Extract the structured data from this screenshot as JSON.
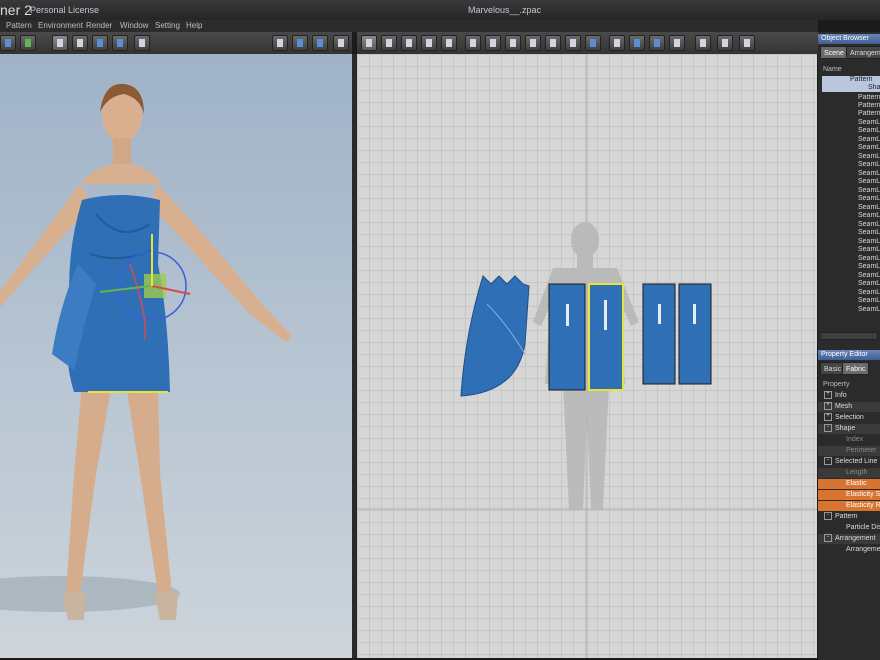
{
  "window": {
    "app_title": "ner 2",
    "license": "Personal License",
    "file_title": "Marvelous__.zpac"
  },
  "menu": [
    "Pattern",
    "Environment",
    "Render",
    "Window",
    "Setting",
    "Help"
  ],
  "object_browser": {
    "title": "Object Browser",
    "tabs": [
      "Scene",
      "Arrangem"
    ],
    "column": "Name",
    "rows": [
      "Pattern",
      "Sha",
      "Pattern",
      "Pattern",
      "Pattern",
      "SeamL",
      "SeamL",
      "SeamL",
      "SeamL",
      "SeamL",
      "SeamL",
      "SeamL",
      "SeamL",
      "SeamL",
      "SeamL",
      "SeamL",
      "SeamL",
      "SeamL",
      "SeamL",
      "SeamL",
      "SeamL",
      "SeamL",
      "SeamL",
      "SeamL",
      "SeamL",
      "SeamL",
      "SeamL",
      "SeamL"
    ]
  },
  "property_editor": {
    "title": "Property Editor",
    "tabs": [
      "Basic",
      "Fabric"
    ],
    "column": "Property",
    "rows": [
      {
        "label": "Info",
        "kind": "group"
      },
      {
        "label": "Mesh",
        "kind": "group"
      },
      {
        "label": "Selection",
        "kind": "group"
      },
      {
        "label": "Shape",
        "kind": "group"
      },
      {
        "label": "Index",
        "kind": "dim"
      },
      {
        "label": "Perimeter",
        "kind": "dim"
      },
      {
        "label": "Selected Line",
        "kind": "group"
      },
      {
        "label": "Length",
        "kind": "dim"
      },
      {
        "label": "Elastic",
        "kind": "orange"
      },
      {
        "label": "Elasticity S",
        "kind": "orange"
      },
      {
        "label": "Elasticity R",
        "kind": "orange"
      },
      {
        "label": "Pattern",
        "kind": "group"
      },
      {
        "label": "Particle Dis",
        "kind": "child"
      },
      {
        "label": "Arrangement",
        "kind": "group"
      },
      {
        "label": "Arrangeme",
        "kind": "child"
      }
    ]
  },
  "colors": {
    "fabric": "#2f6fb5",
    "selected_outline": "#e8e23a",
    "panel_header": "#4f6ea6",
    "orange_row": "#d8742f"
  }
}
